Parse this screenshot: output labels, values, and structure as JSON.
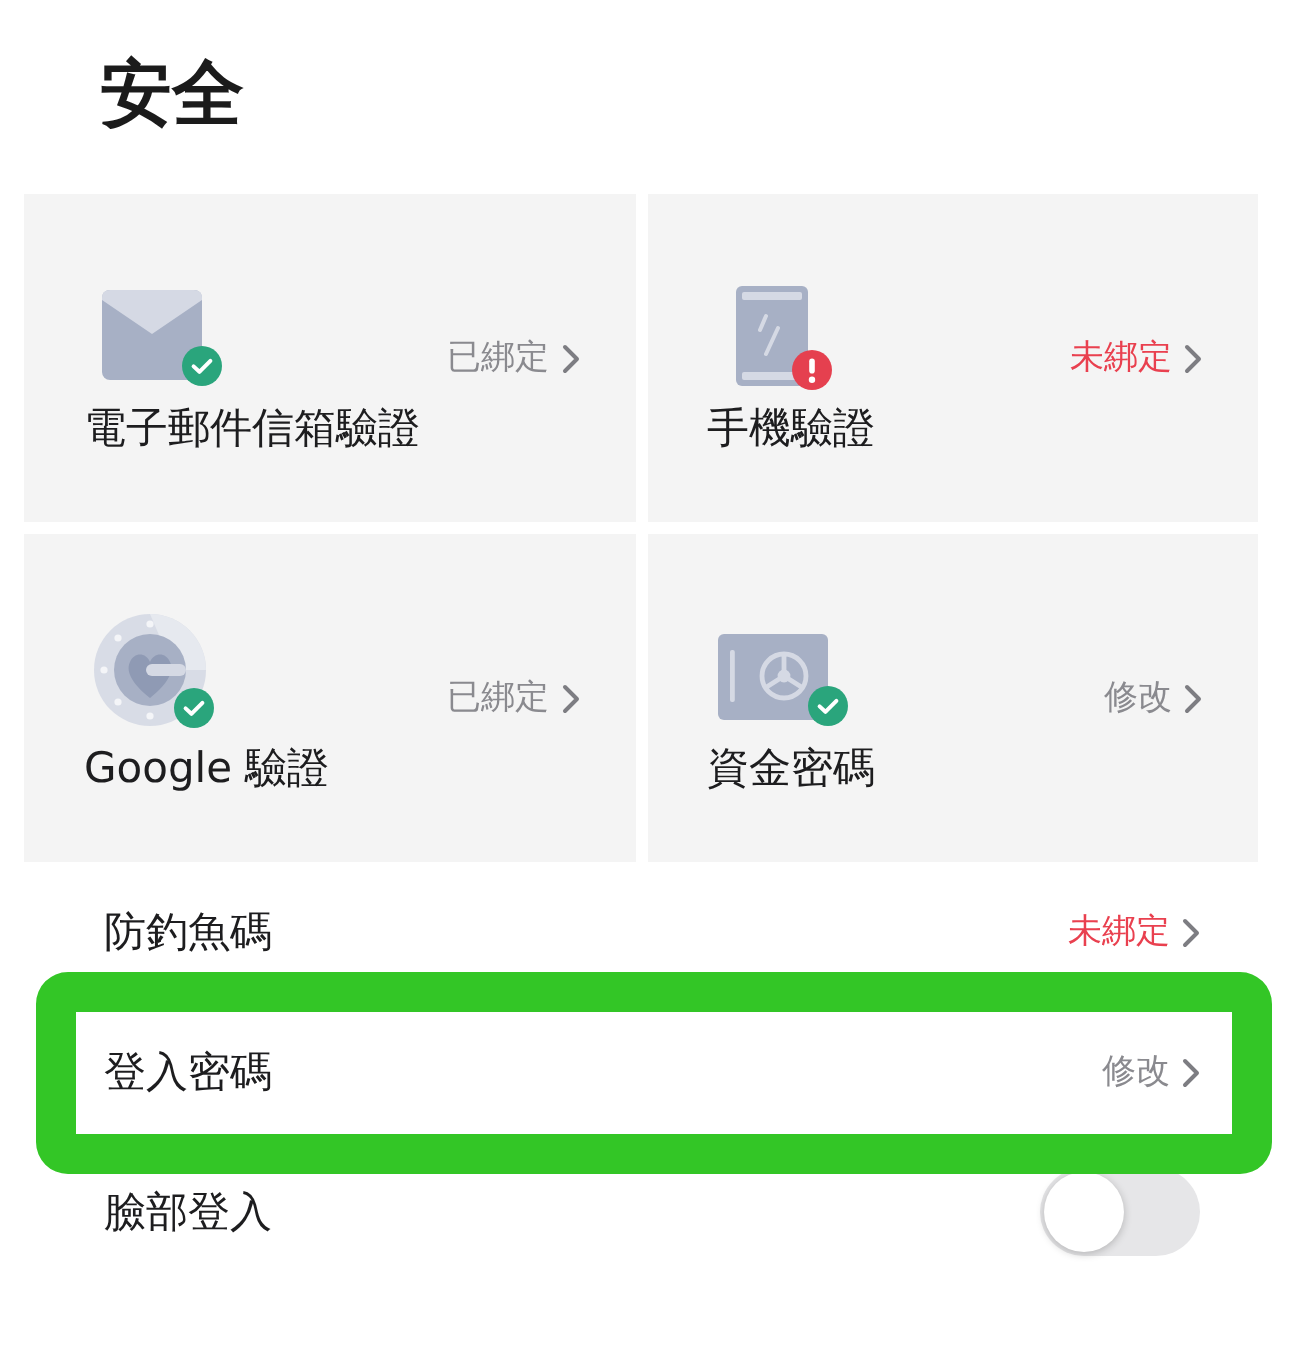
{
  "title": "安全",
  "cards": [
    {
      "kind": "mail",
      "label": "電子郵件信箱驗證",
      "status": "已綁定",
      "bound": true
    },
    {
      "kind": "phone",
      "label": "手機驗證",
      "status": "未綁定",
      "bound": false
    },
    {
      "kind": "authenticator",
      "label": "Google 驗證",
      "status": "已綁定",
      "bound": true
    },
    {
      "kind": "safe",
      "label": "資金密碼",
      "status": "修改",
      "bound": true
    }
  ],
  "rows": [
    {
      "kind": "link",
      "label": "防釣魚碼",
      "status": "未綁定",
      "bound": false,
      "highlighted": false
    },
    {
      "kind": "link",
      "label": "登入密碼",
      "status": "修改",
      "bound": true,
      "highlighted": true
    },
    {
      "kind": "toggle",
      "label": "臉部登入",
      "on": false,
      "highlighted": false
    }
  ]
}
